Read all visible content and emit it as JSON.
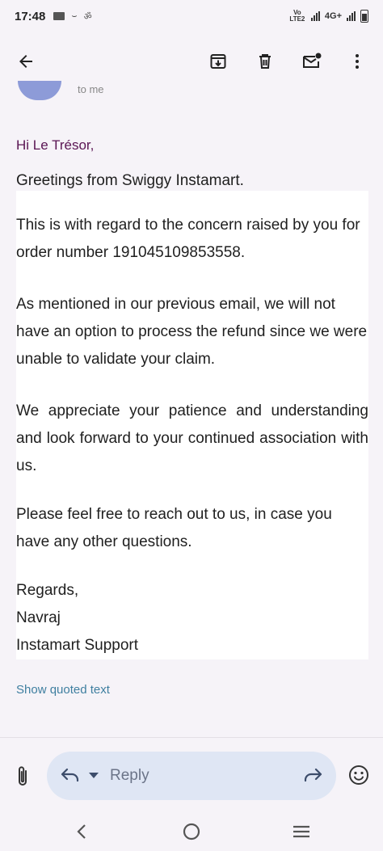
{
  "status_bar": {
    "time": "17:48",
    "network": "4G+",
    "volte": "Vo LTE2"
  },
  "toolbar": {
    "back_icon": "arrow-left-icon",
    "archive_icon": "archive-icon",
    "delete_icon": "trash-icon",
    "unread_icon": "mark-unread-icon",
    "more_icon": "more-vertical-icon"
  },
  "header": {
    "to_peek": "to me"
  },
  "email": {
    "greeting": "Hi Le Trésor,",
    "paragraphs": [
      "Greetings from Swiggy Instamart.",
      "This is with regard to the concern raised by you for order number 191045109853558.",
      "As mentioned in our previous email, we will not have an option to process the refund since we were unable to validate your claim.",
      "We appreciate your patience and understanding and look forward to your continued association with us.",
      "Please feel free to reach out to us, in case you have any other questions."
    ],
    "signoff": [
      "Regards,",
      "Navraj",
      "Instamart Support"
    ],
    "show_quoted": "Show quoted text"
  },
  "composer": {
    "reply_label": "Reply",
    "attach_icon": "paperclip-icon",
    "emoji_icon": "emoji-icon"
  },
  "colors": {
    "background": "#f6f3f8",
    "greeting": "#5a1553",
    "link": "#3f7fa0",
    "reply_pill": "#dfe6f4"
  }
}
